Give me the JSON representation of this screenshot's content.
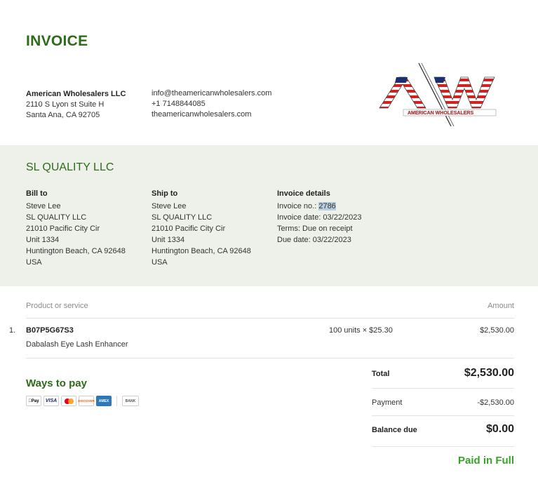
{
  "invoice": {
    "title": "INVOICE"
  },
  "company": {
    "name": "American Wholesalers LLC",
    "address_line1": "2110 S Lyon st Suite H",
    "address_line2": "Santa Ana, CA 92705",
    "email": "info@theamericanwholesalers.com",
    "phone": "+1 7148844085",
    "website": "theamericanwholesalers.com",
    "logo_text": "AMERICAN WHOLESALERS",
    "logo_letters": "AW"
  },
  "customer": {
    "name": "SL QUALITY LLC"
  },
  "bill_to": {
    "heading": "Bill to",
    "lines": [
      "Steve Lee",
      "SL QUALITY LLC",
      "21010 Pacific City Cir",
      "Unit 1334",
      "Huntington Beach, CA 92648",
      "USA"
    ]
  },
  "ship_to": {
    "heading": "Ship to",
    "lines": [
      "Steve Lee",
      "SL QUALITY LLC",
      "21010 Pacific City Cir",
      "Unit 1334",
      "Huntington Beach, CA 92648",
      "USA"
    ]
  },
  "details": {
    "heading": "Invoice details",
    "number_label": "Invoice no.: ",
    "number": "2786",
    "date": "Invoice date: 03/22/2023",
    "terms": "Terms: Due on receipt",
    "due": "Due date: 03/22/2023"
  },
  "table": {
    "col_product": "Product or service",
    "col_amount": "Amount",
    "rows": [
      {
        "no": "1.",
        "sku": "B07P5G67S3",
        "description": "Dabalash Eye Lash Enhancer",
        "qty": "100 units × $25.30",
        "amount": "$2,530.00"
      }
    ]
  },
  "ways_to_pay": {
    "heading": "Ways to pay",
    "methods": [
      "Pay",
      "VISA",
      "DISCOVER",
      "AMEX",
      "BANK"
    ]
  },
  "summary": {
    "total_label": "Total",
    "total_value": "$2,530.00",
    "payment_label": "Payment",
    "payment_value": "-$2,530.00",
    "balance_label": "Balance due",
    "balance_value": "$0.00",
    "status": "Paid in Full"
  },
  "colors": {
    "accent_green": "#2e6b1a",
    "paid_green": "#3aa12a",
    "band_bg": "#eef1ea"
  }
}
